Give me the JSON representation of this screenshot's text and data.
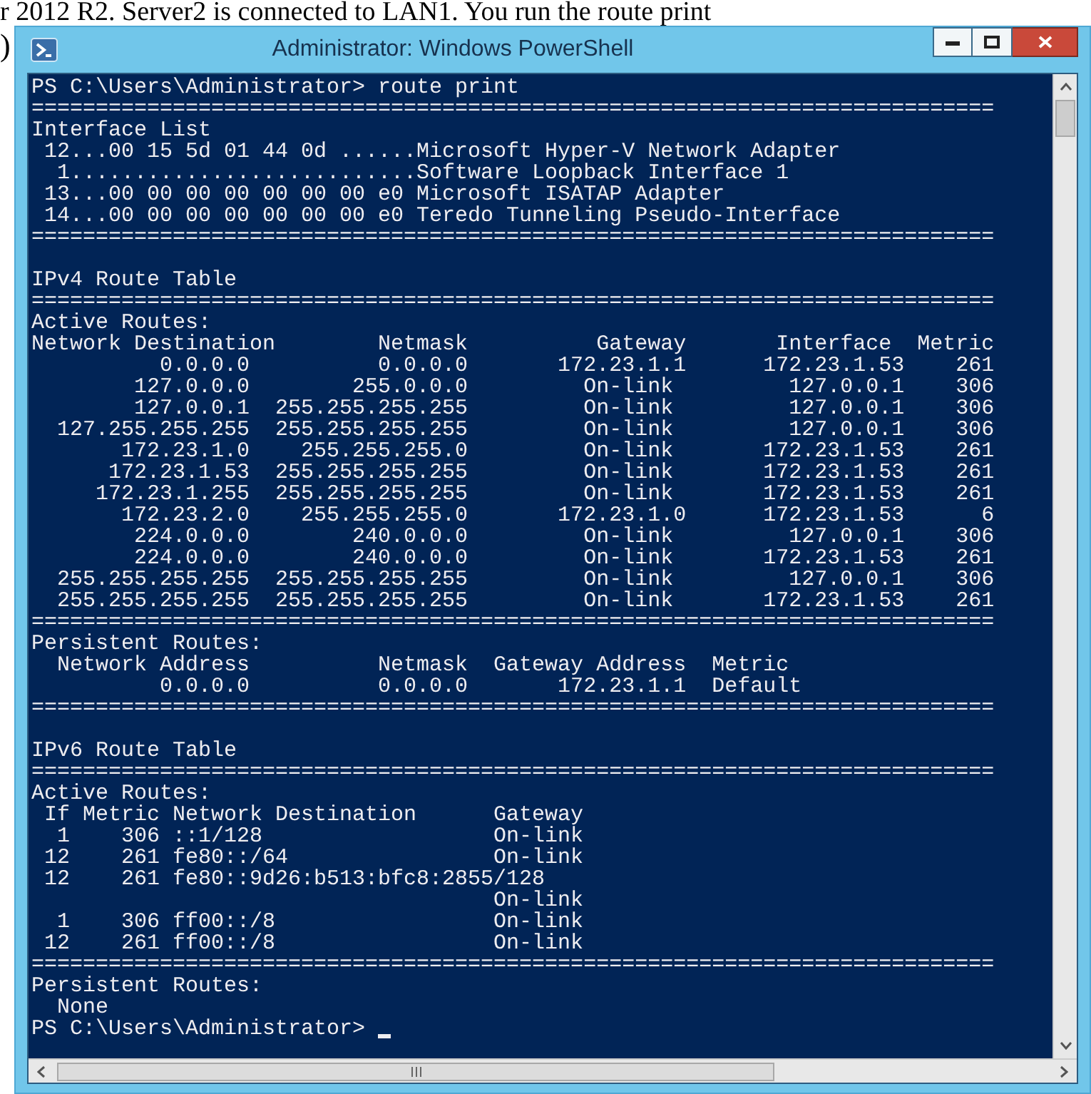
{
  "context_text": {
    "line": "r 2012 R2. Server2 is connected to LAN1. You run the route print",
    "fragment": ")"
  },
  "window": {
    "title": "Administrator: Windows PowerShell"
  },
  "console": {
    "cursor": true,
    "blocks": [
      [
        "PS C:\\Users\\Administrator> route print",
        "===========================================================================",
        "Interface List",
        " 12...00 15 5d 01 44 0d ......Microsoft Hyper-V Network Adapter",
        "  1...........................Software Loopback Interface 1",
        " 13...00 00 00 00 00 00 00 e0 Microsoft ISATAP Adapter",
        " 14...00 00 00 00 00 00 00 e0 Teredo Tunneling Pseudo-Interface",
        "==========================================================================="
      ],
      [
        "IPv4 Route Table",
        "===========================================================================",
        "Active Routes:",
        "Network Destination        Netmask          Gateway       Interface  Metric",
        "          0.0.0.0          0.0.0.0       172.23.1.1      172.23.1.53    261",
        "        127.0.0.0        255.0.0.0         On-link         127.0.0.1    306",
        "        127.0.0.1  255.255.255.255         On-link         127.0.0.1    306",
        "  127.255.255.255  255.255.255.255         On-link         127.0.0.1    306",
        "       172.23.1.0    255.255.255.0         On-link       172.23.1.53    261",
        "      172.23.1.53  255.255.255.255         On-link       172.23.1.53    261",
        "     172.23.1.255  255.255.255.255         On-link       172.23.1.53    261",
        "       172.23.2.0    255.255.255.0       172.23.1.0      172.23.1.53      6",
        "        224.0.0.0        240.0.0.0         On-link         127.0.0.1    306",
        "        224.0.0.0        240.0.0.0         On-link       172.23.1.53    261",
        "  255.255.255.255  255.255.255.255         On-link         127.0.0.1    306",
        "  255.255.255.255  255.255.255.255         On-link       172.23.1.53    261",
        "===========================================================================",
        "Persistent Routes:",
        "  Network Address          Netmask  Gateway Address  Metric",
        "          0.0.0.0          0.0.0.0       172.23.1.1  Default",
        "==========================================================================="
      ],
      [
        "IPv6 Route Table",
        "===========================================================================",
        "Active Routes:",
        " If Metric Network Destination      Gateway",
        "  1    306 ::1/128                  On-link",
        " 12    261 fe80::/64                On-link",
        " 12    261 fe80::9d26:b513:bfc8:2855/128",
        "                                    On-link",
        "  1    306 ff00::/8                 On-link",
        " 12    261 ff00::/8                 On-link",
        "===========================================================================",
        "Persistent Routes:",
        "  None",
        "PS C:\\Users\\Administrator>"
      ]
    ]
  }
}
